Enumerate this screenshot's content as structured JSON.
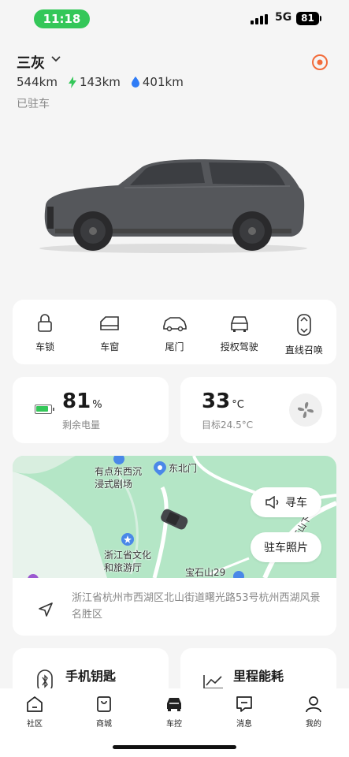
{
  "status": {
    "time": "11:18",
    "network": "5G",
    "battery": "81"
  },
  "header": {
    "car_name": "三灰",
    "total_range": "544km",
    "electric_range": "143km",
    "fuel_range": "401km",
    "status_text": "已驻车"
  },
  "controls": [
    {
      "label": "车锁",
      "icon": "lock-icon"
    },
    {
      "label": "车窗",
      "icon": "window-icon"
    },
    {
      "label": "尾门",
      "icon": "tailgate-icon"
    },
    {
      "label": "授权驾驶",
      "icon": "authorize-drive-icon"
    },
    {
      "label": "直线召唤",
      "icon": "summon-icon"
    }
  ],
  "battery_card": {
    "value": "81",
    "unit": "%",
    "label": "剩余电量"
  },
  "climate_card": {
    "value": "33",
    "unit": "°C",
    "label": "目标24.5°C"
  },
  "map": {
    "labels": {
      "theater": "有点东西沉\n浸式剧场",
      "north_gate": "东北门",
      "museum": "浙江省文化\n和旅游厅",
      "mountain": "宝石山29",
      "road": "宝石山下"
    },
    "find_car_label": "寻车",
    "photos_label": "驻车照片"
  },
  "address": "浙江省杭州市西湖区北山街道曙光路53号杭州西湖风景名胜区",
  "features": {
    "phone_key": "手机钥匙",
    "mileage": "里程能耗"
  },
  "tabs": [
    {
      "label": "社区",
      "icon": "home-icon"
    },
    {
      "label": "商城",
      "icon": "shop-bag-icon"
    },
    {
      "label": "车控",
      "icon": "car-control-icon"
    },
    {
      "label": "消息",
      "icon": "message-icon"
    },
    {
      "label": "我的",
      "icon": "profile-icon"
    }
  ],
  "colors": {
    "accent_green": "#34c759",
    "map_green": "#b4e6c6",
    "target_orange": "#f26b3a",
    "fuel_blue": "#2f7cf6"
  }
}
